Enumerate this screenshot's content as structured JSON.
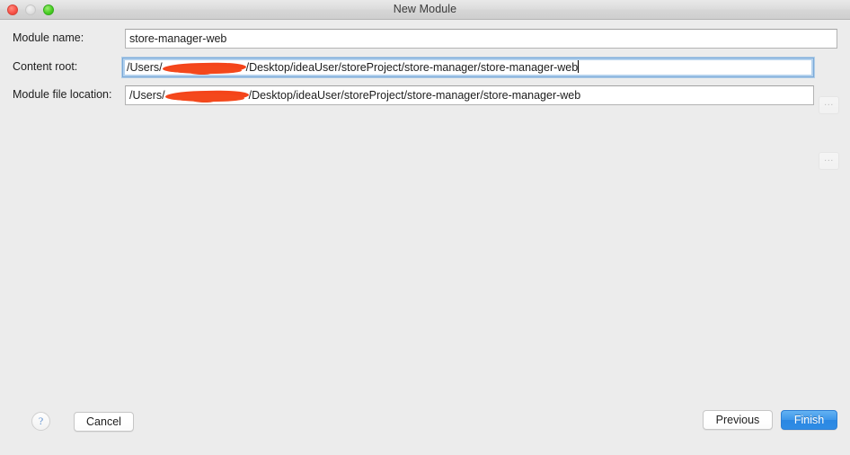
{
  "window": {
    "title": "New Module",
    "traffic_lights": [
      {
        "name": "close",
        "color": "#f9544a"
      },
      {
        "name": "minimize",
        "color": "#dfdfdf"
      },
      {
        "name": "maximize",
        "color": "#4cd026"
      }
    ]
  },
  "form": {
    "fields": [
      {
        "label": "Module name:",
        "value": "store-manager-web",
        "focused": false,
        "has_browse": false
      },
      {
        "label": "Content root:",
        "value_prefix": "/Users/",
        "value_suffix": "/Desktop/ideaUser/storeProject/store-manager/store-manager-web",
        "redacted": true,
        "focused": true,
        "has_caret": true,
        "has_browse": true,
        "browse_label": "..."
      },
      {
        "label": "Module file location:",
        "value_prefix": "/Users/",
        "value_suffix": "/Desktop/ideaUser/storeProject/store-manager/store-manager-web",
        "redacted": true,
        "focused": false,
        "has_caret": false,
        "has_browse": true,
        "browse_label": "..."
      }
    ]
  },
  "footer": {
    "help_label": "?",
    "cancel_label": "Cancel",
    "previous_label": "Previous",
    "finish_label": "Finish"
  },
  "colors": {
    "window_background": "#ececec",
    "titlebar_top": "#e9e9e9",
    "titlebar_bottom": "#cfcfcf",
    "field_background": "#ffffff",
    "focus_ring": "#7aa9d8",
    "primary_button": "#3d96ea",
    "redaction": "#f4441a",
    "text": "#1d1d1d"
  }
}
